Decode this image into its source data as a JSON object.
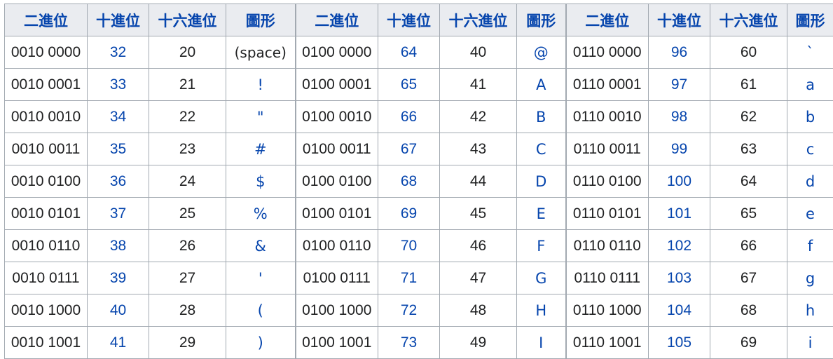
{
  "headers": [
    "二進位",
    "十進位",
    "十六進位",
    "圖形"
  ],
  "groups": [
    {
      "rows": [
        {
          "bin": "0010 0000",
          "dec": "32",
          "hex": "20",
          "glyph": "(space)"
        },
        {
          "bin": "0010 0001",
          "dec": "33",
          "hex": "21",
          "glyph": "!"
        },
        {
          "bin": "0010 0010",
          "dec": "34",
          "hex": "22",
          "glyph": "\""
        },
        {
          "bin": "0010 0011",
          "dec": "35",
          "hex": "23",
          "glyph": "#"
        },
        {
          "bin": "0010 0100",
          "dec": "36",
          "hex": "24",
          "glyph": "$"
        },
        {
          "bin": "0010 0101",
          "dec": "37",
          "hex": "25",
          "glyph": "%"
        },
        {
          "bin": "0010 0110",
          "dec": "38",
          "hex": "26",
          "glyph": "&"
        },
        {
          "bin": "0010 0111",
          "dec": "39",
          "hex": "27",
          "glyph": "'"
        },
        {
          "bin": "0010 1000",
          "dec": "40",
          "hex": "28",
          "glyph": "("
        },
        {
          "bin": "0010 1001",
          "dec": "41",
          "hex": "29",
          "glyph": ")"
        }
      ]
    },
    {
      "rows": [
        {
          "bin": "0100 0000",
          "dec": "64",
          "hex": "40",
          "glyph": "@"
        },
        {
          "bin": "0100 0001",
          "dec": "65",
          "hex": "41",
          "glyph": "A"
        },
        {
          "bin": "0100 0010",
          "dec": "66",
          "hex": "42",
          "glyph": "B"
        },
        {
          "bin": "0100 0011",
          "dec": "67",
          "hex": "43",
          "glyph": "C"
        },
        {
          "bin": "0100 0100",
          "dec": "68",
          "hex": "44",
          "glyph": "D"
        },
        {
          "bin": "0100 0101",
          "dec": "69",
          "hex": "45",
          "glyph": "E"
        },
        {
          "bin": "0100 0110",
          "dec": "70",
          "hex": "46",
          "glyph": "F"
        },
        {
          "bin": "0100 0111",
          "dec": "71",
          "hex": "47",
          "glyph": "G"
        },
        {
          "bin": "0100 1000",
          "dec": "72",
          "hex": "48",
          "glyph": "H"
        },
        {
          "bin": "0100 1001",
          "dec": "73",
          "hex": "49",
          "glyph": "I"
        }
      ]
    },
    {
      "rows": [
        {
          "bin": "0110 0000",
          "dec": "96",
          "hex": "60",
          "glyph": "`"
        },
        {
          "bin": "0110 0001",
          "dec": "97",
          "hex": "61",
          "glyph": "a"
        },
        {
          "bin": "0110 0010",
          "dec": "98",
          "hex": "62",
          "glyph": "b"
        },
        {
          "bin": "0110 0011",
          "dec": "99",
          "hex": "63",
          "glyph": "c"
        },
        {
          "bin": "0110 0100",
          "dec": "100",
          "hex": "64",
          "glyph": "d"
        },
        {
          "bin": "0110 0101",
          "dec": "101",
          "hex": "65",
          "glyph": "e"
        },
        {
          "bin": "0110 0110",
          "dec": "102",
          "hex": "66",
          "glyph": "f"
        },
        {
          "bin": "0110 0111",
          "dec": "103",
          "hex": "67",
          "glyph": "g"
        },
        {
          "bin": "0110 1000",
          "dec": "104",
          "hex": "68",
          "glyph": "h"
        },
        {
          "bin": "0110 1001",
          "dec": "105",
          "hex": "69",
          "glyph": "i"
        }
      ]
    }
  ],
  "colors": {
    "link": "#0645ad",
    "header_bg": "#eaecf0",
    "border": "#a2a9b1",
    "text": "#202122"
  }
}
